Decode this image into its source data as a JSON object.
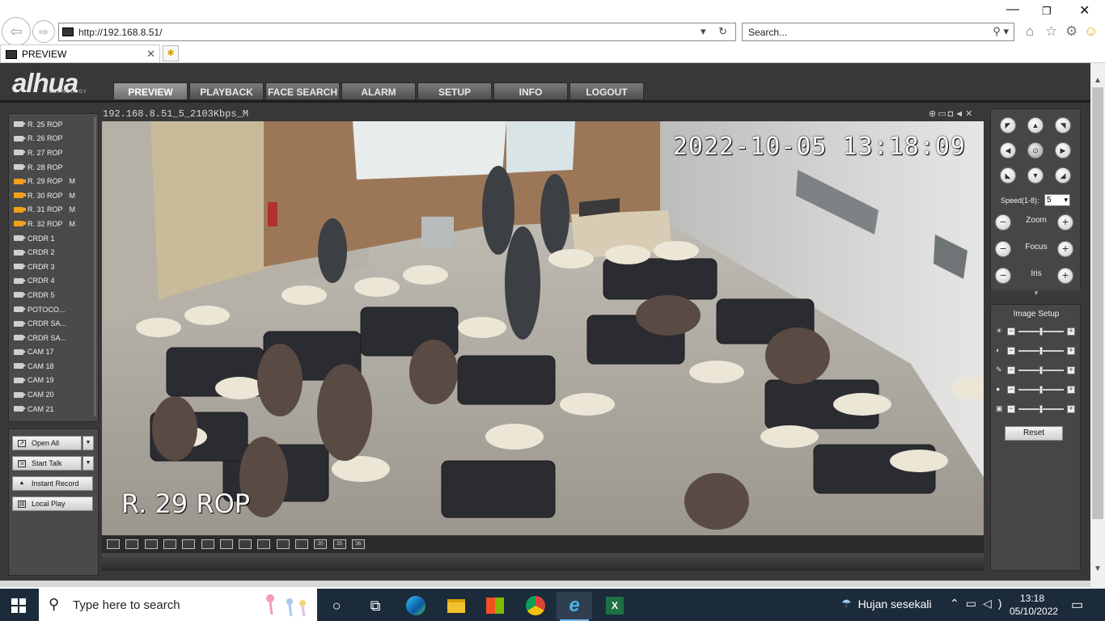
{
  "browser": {
    "address": "http://192.168.8.51/",
    "search_placeholder": "Search...",
    "tab_title": "PREVIEW"
  },
  "app": {
    "logo": "alhua",
    "logo_sub": "TECHNOLOGY",
    "menu": [
      "PREVIEW",
      "PLAYBACK",
      "FACE SEARCH",
      "ALARM",
      "SETUP",
      "INFO",
      "LOGOUT"
    ],
    "active_menu": "PREVIEW"
  },
  "cameras": [
    {
      "name": "R. 25 ROP",
      "rec": false,
      "flag": ""
    },
    {
      "name": "R. 26 ROP",
      "rec": false,
      "flag": ""
    },
    {
      "name": "R. 27 ROP",
      "rec": false,
      "flag": ""
    },
    {
      "name": "R. 28 ROP",
      "rec": false,
      "flag": ""
    },
    {
      "name": "R. 29 ROP",
      "rec": true,
      "flag": "M"
    },
    {
      "name": "R. 30 ROP",
      "rec": true,
      "flag": "M"
    },
    {
      "name": "R. 31 ROP",
      "rec": true,
      "flag": "M"
    },
    {
      "name": "R. 32 ROP",
      "rec": true,
      "flag": "M"
    },
    {
      "name": "CRDR 1",
      "rec": false,
      "flag": ""
    },
    {
      "name": "CRDR 2",
      "rec": false,
      "flag": ""
    },
    {
      "name": "CRDR 3",
      "rec": false,
      "flag": ""
    },
    {
      "name": "CRDR 4",
      "rec": false,
      "flag": ""
    },
    {
      "name": "CRDR 5",
      "rec": false,
      "flag": ""
    },
    {
      "name": "POTOCO...",
      "rec": false,
      "flag": ""
    },
    {
      "name": "CRDR SA...",
      "rec": false,
      "flag": ""
    },
    {
      "name": "CRDR SA...",
      "rec": false,
      "flag": ""
    },
    {
      "name": "CAM 17",
      "rec": false,
      "flag": ""
    },
    {
      "name": "CAM 18",
      "rec": false,
      "flag": ""
    },
    {
      "name": "CAM 19",
      "rec": false,
      "flag": ""
    },
    {
      "name": "CAM 20",
      "rec": false,
      "flag": ""
    },
    {
      "name": "CAM 21",
      "rec": false,
      "flag": ""
    }
  ],
  "left_controls": {
    "open_all": "Open All",
    "start_talk": "Start Talk",
    "instant_record": "Instant Record",
    "local_play": "Local Play"
  },
  "video": {
    "stream_title": "192.168.8.51_5_2103Kbps_M",
    "osd_time": "2022-10-05 13:18:09",
    "osd_name": "R. 29 ROP",
    "layouts": [
      "1x1",
      "2x2",
      "full",
      "wide",
      "1",
      "4",
      "6",
      "8",
      "9",
      "13",
      "16",
      "20",
      "25",
      "36"
    ]
  },
  "ptz": {
    "speed_label": "Speed(1-8):",
    "speed_value": "5",
    "zoom": "Zoom",
    "focus": "Focus",
    "iris": "Iris"
  },
  "image_setup": {
    "title": "Image Setup",
    "reset": "Reset",
    "sliders": [
      {
        "icon": "brightness-icon",
        "level": 0.5
      },
      {
        "icon": "contrast-icon",
        "level": 0.5
      },
      {
        "icon": "saturation-icon",
        "level": 0.5
      },
      {
        "icon": "hue-icon",
        "level": 0.5
      },
      {
        "icon": "gain-icon",
        "level": 0.5
      }
    ]
  },
  "taskbar": {
    "search_placeholder": "Type here to search",
    "weather": "Hujan sesekali",
    "time": "13:18",
    "date": "05/10/2022"
  },
  "colors": {
    "page_bg": "#383838",
    "rec_orange": "#f2a01d",
    "taskbar": "#1c2b3a"
  }
}
